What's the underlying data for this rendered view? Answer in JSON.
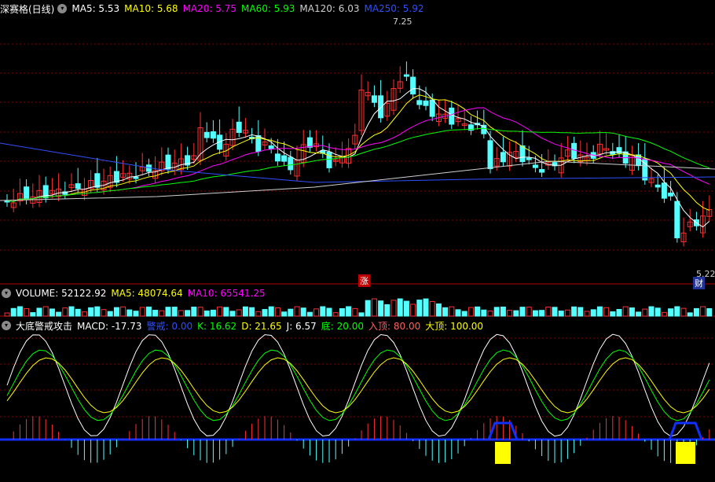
{
  "main_panel": {
    "title": "深赛格(日线)",
    "indicators": [
      {
        "label": "MA5: 5.53",
        "color": "#ffffff"
      },
      {
        "label": "MA10: 5.68",
        "color": "#ffff00"
      },
      {
        "label": "MA20: 5.75",
        "color": "#ff00ff"
      },
      {
        "label": "MA60: 5.93",
        "color": "#00ff00"
      },
      {
        "label": "MA120: 6.03",
        "color": "#d0d0d0"
      },
      {
        "label": "MA250: 5.92",
        "color": "#3050ff"
      }
    ],
    "high_label": "7.25",
    "low_label": "5.22",
    "marker_zhang": "涨",
    "marker_cai": "财"
  },
  "volume_panel": {
    "indicators": [
      {
        "label": "VOLUME: 52122.92",
        "color": "#ffffff"
      },
      {
        "label": "MA5: 48074.64",
        "color": "#ffff00"
      },
      {
        "label": "MA10: 65541.25",
        "color": "#ff00ff"
      }
    ]
  },
  "indicator_panel": {
    "title": "大底警戒攻击",
    "indicators": [
      {
        "label": "MACD: -17.73",
        "color": "#ffffff"
      },
      {
        "label": "警戒: 0.00",
        "color": "#3050ff"
      },
      {
        "label": "K: 16.62",
        "color": "#00ff00"
      },
      {
        "label": "D: 21.65",
        "color": "#ffff00"
      },
      {
        "label": "J: 6.57",
        "color": "#ffffff"
      },
      {
        "label": "底: 20.00",
        "color": "#00ff00"
      },
      {
        "label": "入顶: 80.00",
        "color": "#ff6060"
      },
      {
        "label": "大顶: 100.00",
        "color": "#ffff00"
      }
    ]
  },
  "colors": {
    "up": "#ff3030",
    "down": "#54ffff",
    "grid": "#8b0000"
  }
}
